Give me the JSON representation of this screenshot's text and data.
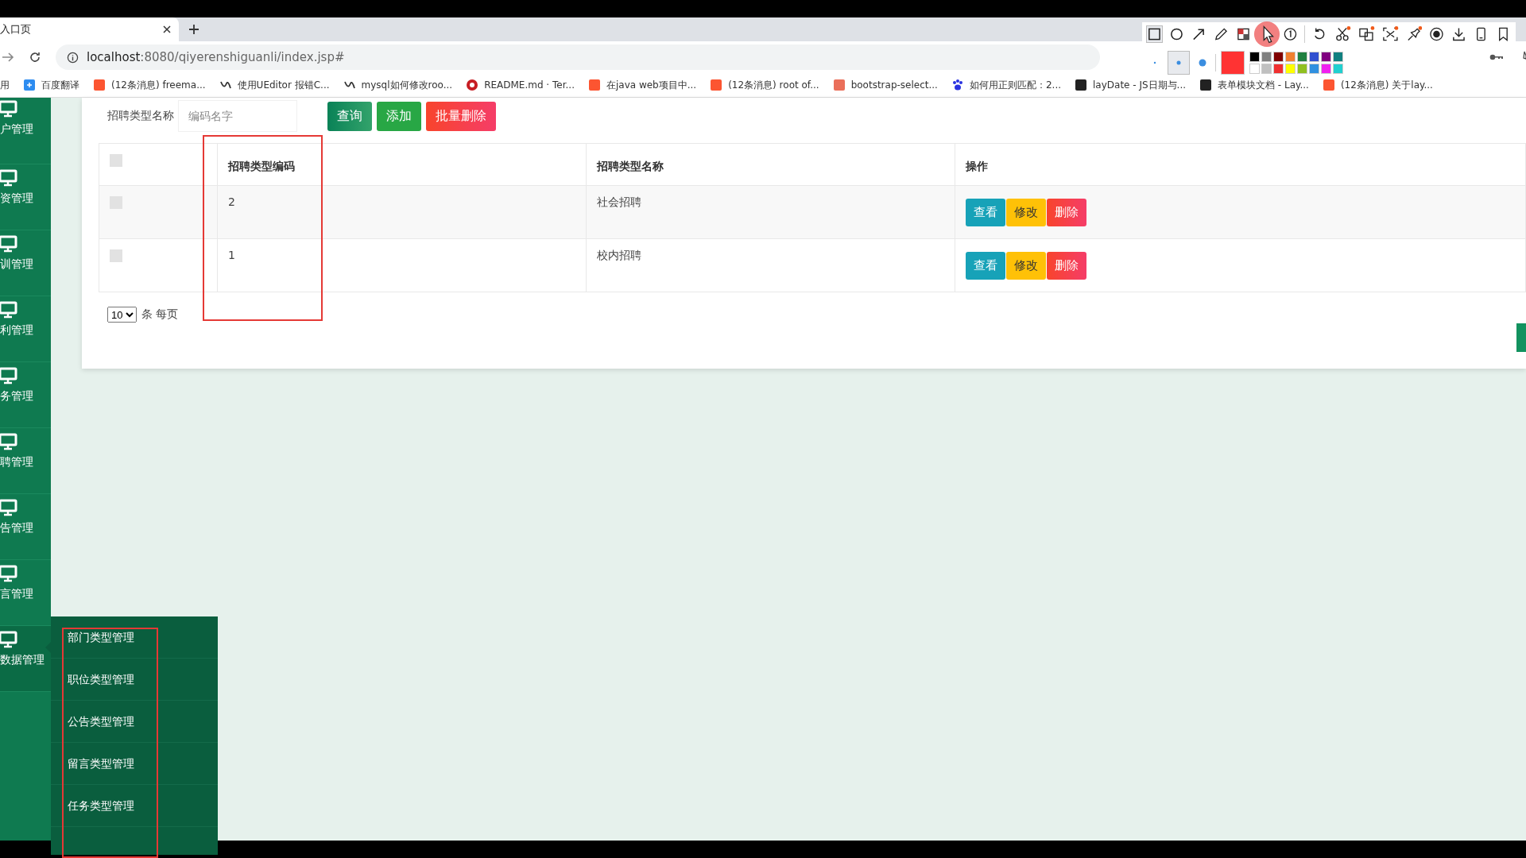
{
  "browser": {
    "tab_title": "入口页",
    "url_host": "localhost",
    "url_rest": ":8080/qiyerenshiguanli/index.jsp#",
    "bookmarks": [
      {
        "kind": "apps",
        "label": "用"
      },
      {
        "kind": "translate",
        "label": "百度翻译"
      },
      {
        "kind": "csdn",
        "label": "(12条消息) freema..."
      },
      {
        "kind": "ueditor",
        "label": "使用UEditor 报错C..."
      },
      {
        "kind": "ueditor",
        "label": "mysql如何修改roo..."
      },
      {
        "kind": "gitee",
        "label": "README.md · Ter..."
      },
      {
        "kind": "csdn",
        "label": "在java web项目中..."
      },
      {
        "kind": "csdn",
        "label": "(12条消息) root of..."
      },
      {
        "kind": "jianshu",
        "label": "bootstrap-select..."
      },
      {
        "kind": "baidu",
        "label": "如何用正则匹配：2..."
      },
      {
        "kind": "layui",
        "label": "layDate - JS日期与..."
      },
      {
        "kind": "layui",
        "label": "表单模块文档 - Lay..."
      },
      {
        "kind": "csdn",
        "label": "(12条消息) 关于lay..."
      }
    ]
  },
  "capture_tool": {
    "palette": [
      {
        "color": "#000000"
      },
      {
        "color": "#808080"
      },
      {
        "color": "#800000"
      },
      {
        "color": "#f08030"
      },
      {
        "color": "#208040"
      },
      {
        "color": "#3050d0"
      },
      {
        "color": "#800080"
      },
      {
        "color": "#108080"
      },
      {
        "color": "#ffffff"
      },
      {
        "color": "#c0c0c0"
      },
      {
        "color": "#f03030"
      },
      {
        "color": "#ffff00"
      },
      {
        "color": "#90c020"
      },
      {
        "color": "#3090e0"
      },
      {
        "color": "#f020f0"
      },
      {
        "color": "#20d0d0"
      }
    ]
  },
  "sidebar": {
    "items": [
      {
        "label": "户管理",
        "expanded": false
      },
      {
        "label": "资管理",
        "expanded": false
      },
      {
        "label": "训管理",
        "expanded": false
      },
      {
        "label": "利管理",
        "expanded": false
      },
      {
        "label": "务管理",
        "expanded": false
      },
      {
        "label": "聘管理",
        "expanded": false
      },
      {
        "label": "告管理",
        "expanded": false
      },
      {
        "label": "言管理",
        "expanded": false
      },
      {
        "label": "数据管理",
        "expanded": true,
        "children": [
          {
            "label": "部门类型管理"
          },
          {
            "label": "职位类型管理"
          },
          {
            "label": "公告类型管理"
          },
          {
            "label": "留言类型管理"
          },
          {
            "label": "任务类型管理"
          }
        ]
      }
    ]
  },
  "search": {
    "label": "招聘类型名称",
    "placeholder": "编码名字",
    "buttons": [
      {
        "kind": "query",
        "label": "查询"
      },
      {
        "kind": "add",
        "label": "添加"
      },
      {
        "kind": "delete",
        "label": "批量删除"
      }
    ]
  },
  "table": {
    "header_checked": false,
    "columns": [
      "招聘类型编码",
      "招聘类型名称",
      "操作"
    ],
    "rows": [
      {
        "checked": false,
        "code": "2",
        "name": "社会招聘",
        "actions": [
          {
            "kind": "view",
            "label": "查看"
          },
          {
            "kind": "edit",
            "label": "修改"
          },
          {
            "kind": "delete",
            "label": "删除"
          }
        ]
      },
      {
        "checked": false,
        "code": "1",
        "name": "校内招聘",
        "actions": [
          {
            "kind": "view",
            "label": "查看"
          },
          {
            "kind": "edit",
            "label": "修改"
          },
          {
            "kind": "delete",
            "label": "删除"
          }
        ]
      }
    ]
  },
  "pagination": {
    "page_size": "10",
    "per_page_label": "条 每页"
  }
}
